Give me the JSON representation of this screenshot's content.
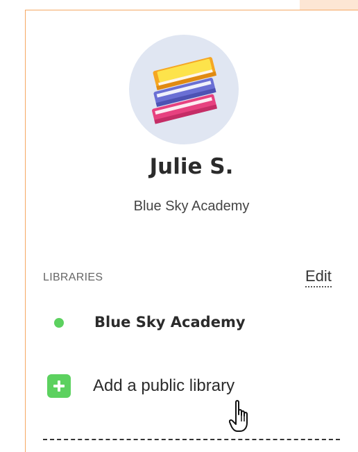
{
  "profile": {
    "avatar_icon": "stack-of-books-icon",
    "name": "Julie S.",
    "school": "Blue Sky Academy"
  },
  "libraries": {
    "section_label": "LIBRARIES",
    "edit_label": "Edit",
    "items": [
      {
        "name": "Blue Sky Academy",
        "status_color": "#5cd15f"
      }
    ],
    "add_label": "Add a public library",
    "add_icon": "plus-icon"
  },
  "colors": {
    "panel_border": "#f5a863",
    "avatar_bg": "#e0e6f2",
    "accent_green": "#5cd15f"
  }
}
